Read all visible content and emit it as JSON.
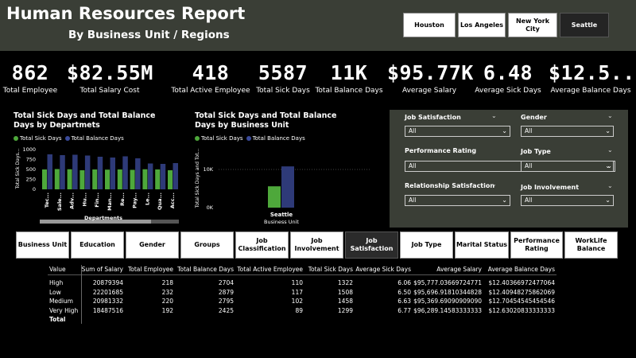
{
  "header": {
    "title": "Human Resources Report",
    "subtitle": "By Business Unit / Regions",
    "cities": [
      "Houston",
      "Los Angeles",
      "New York City",
      "Seattle"
    ],
    "selected_city": "Seattle"
  },
  "kpis": [
    {
      "value": "862",
      "label": "Total Employee"
    },
    {
      "value": "$82.55M",
      "label": "Total Salary Cost"
    },
    {
      "value": "418",
      "label": "Total Active Employee"
    },
    {
      "value": "5587",
      "label": "Total Sick Days"
    },
    {
      "value": "11K",
      "label": "Total Balance Days"
    },
    {
      "value": "$95.77K",
      "label": "Average Salary"
    },
    {
      "value": "6.48",
      "label": "Average Sick Days"
    },
    {
      "value": "$12.5...",
      "label": "Average Balance Days"
    }
  ],
  "colors": {
    "sick": "#4ea83b",
    "balance": "#2e3a78",
    "header_bg": "#3a3e36"
  },
  "chart_data": [
    {
      "type": "bar",
      "title": "Total Sick Days and Total Balance Days by Departmets",
      "xlabel": "Departments",
      "ylabel": "Total Sick Days...",
      "ylim": [
        0,
        1000
      ],
      "yticks": [
        "0",
        "250",
        "500",
        "750",
        "1000"
      ],
      "categories": [
        "Tec...",
        "Sale...",
        "Adv...",
        "Hu...",
        "Fin...",
        "Man...",
        "Re...",
        "Pay...",
        "Le...",
        "Qua...",
        "Acc..."
      ],
      "series": [
        {
          "name": "Total Sick Days",
          "values": [
            500,
            510,
            505,
            480,
            500,
            495,
            500,
            490,
            505,
            500,
            480
          ]
        },
        {
          "name": "Total Balance Days",
          "values": [
            880,
            860,
            870,
            850,
            820,
            800,
            830,
            780,
            650,
            640,
            660
          ]
        }
      ]
    },
    {
      "type": "bar",
      "title": "Total Sick Days and Total Balance Days by Business Unit",
      "xlabel": "Business Unit",
      "ylabel": "Total Sick Days and Tot...",
      "ylim": [
        0,
        15000
      ],
      "yticks": [
        "0K",
        "10K"
      ],
      "categories": [
        "Seattle"
      ],
      "series": [
        {
          "name": "Total Sick Days",
          "values": [
            5587
          ]
        },
        {
          "name": "Total Balance Days",
          "values": [
            10803
          ]
        }
      ]
    }
  ],
  "filters": [
    {
      "label": "Job Satisfaction",
      "value": "All"
    },
    {
      "label": "Gender",
      "value": "All"
    },
    {
      "label": "Performance Rating",
      "value": "All"
    },
    {
      "label": "Job Type",
      "value": "All"
    },
    {
      "label": "Relationship Satisfaction",
      "value": "All"
    },
    {
      "label": "Job Involvement",
      "value": "All"
    }
  ],
  "tabs": [
    "Business Unit",
    "Education",
    "Gender",
    "Groups",
    "Job Classification",
    "Job Involvement",
    "Job Satisfaction",
    "Job Type",
    "Marital Status",
    "Performance Rating",
    "WorkLife Balance"
  ],
  "selected_tab": "Job Satisfaction",
  "matrix": {
    "columns": [
      "Value",
      "Sum of Salary",
      "Total Employee",
      "Total Balance Days",
      "Total Active Employee",
      "Total Sick Days",
      "Average Sick Days",
      "Average Salary",
      "Average Balance Days"
    ],
    "rows": [
      [
        "High",
        "20879394",
        "218",
        "2704",
        "110",
        "1322",
        "6.06",
        "$95,777.03669724771",
        "$12.40366972477064"
      ],
      [
        "Low",
        "22201685",
        "232",
        "2879",
        "117",
        "1508",
        "6.50",
        "$95,696.91810344828",
        "$12.40948275862069"
      ],
      [
        "Medium",
        "20981332",
        "220",
        "2795",
        "102",
        "1458",
        "6.63",
        "$95,369.69090909090",
        "$12.70454545454546"
      ],
      [
        "Very High",
        "18487516",
        "192",
        "2425",
        "89",
        "1299",
        "6.77",
        "$96,289.14583333333",
        "$12.63020833333333"
      ]
    ],
    "total_label": "Total"
  }
}
